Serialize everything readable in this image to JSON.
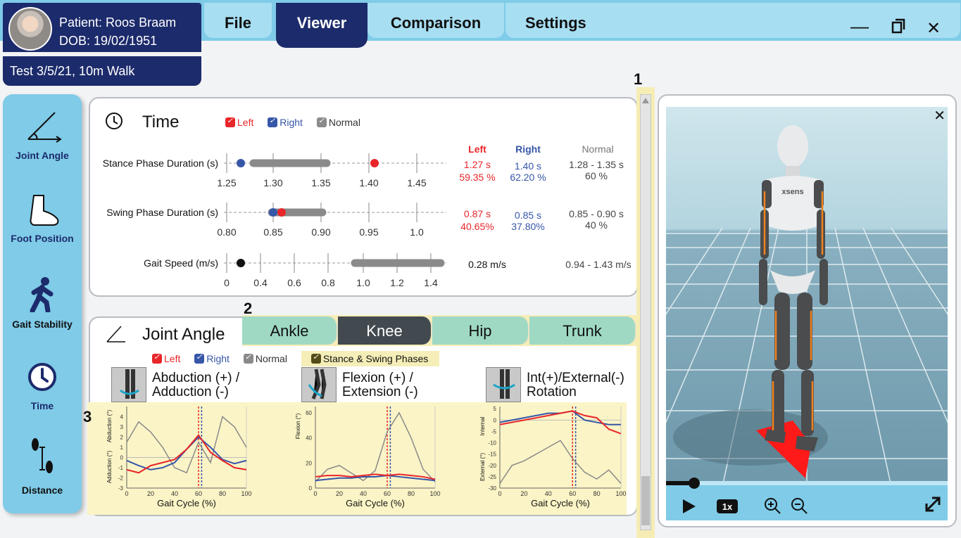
{
  "patient": {
    "name": "Patient: Roos Braam",
    "dob": "DOB: 19/02/1951",
    "test": "Test 3/5/21, 10m Walk"
  },
  "tabs": [
    {
      "label": "File"
    },
    {
      "label": "Viewer"
    },
    {
      "label": "Comparison"
    },
    {
      "label": "Settings"
    }
  ],
  "sidebar": {
    "items": [
      {
        "label": "Joint Angle"
      },
      {
        "label": "Foot Position"
      },
      {
        "label": "Gait Stability"
      },
      {
        "label": "Time"
      },
      {
        "label": "Distance"
      }
    ]
  },
  "colors": {
    "left": "#e8262a",
    "right": "#3656a8",
    "normal": "#8a8a8a",
    "accent": "#7fcbe8",
    "navy": "#1c2b6b"
  },
  "time_panel": {
    "title": "Time",
    "legend": {
      "left": "Left",
      "right": "Right",
      "normal": "Normal"
    },
    "headers": {
      "left": "Left",
      "right": "Right",
      "normal": "Normal"
    },
    "rows": [
      {
        "label": "Stance Phase Duration (s)",
        "ticks": [
          "1.25",
          "1.30",
          "1.35",
          "1.40",
          "1.45"
        ],
        "left_value": "1.27 s",
        "left_pct": "59.35 %",
        "right_value": "1.40 s",
        "right_pct": "62.20 %",
        "normal_value": "1.28 - 1.35 s",
        "normal_pct": "60 %"
      },
      {
        "label": "Swing Phase Duration (s)",
        "ticks": [
          "0.80",
          "0.85",
          "0.90",
          "0.95",
          "1.0"
        ],
        "left_value": "0.87 s",
        "left_pct": "40.65%",
        "right_value": "0.85 s",
        "right_pct": "37.80%",
        "normal_value": "0.85 - 0.90 s",
        "normal_pct": "40 %"
      },
      {
        "label": "Gait Speed (m/s)",
        "ticks": [
          "0",
          "0.4",
          "0.6",
          "0.8",
          "1.0",
          "1.2",
          "1.4"
        ],
        "value": "0.28 m/s",
        "normal_value": "0.94 - 1.43 m/s"
      }
    ]
  },
  "joint_panel": {
    "title": "Joint Angle",
    "tabs": [
      "Ankle",
      "Knee",
      "Hip",
      "Trunk"
    ],
    "active_tab": "Knee",
    "legend": {
      "left": "Left",
      "right": "Right",
      "normal": "Normal",
      "phases": "Stance & Swing Phases"
    },
    "charts": [
      {
        "title1": "Abduction (+) /",
        "title2": "Adduction (-)",
        "ylabel_top": "Abduction (°)",
        "ylabel_bottom": "Adduction (°)",
        "xlabel": "Gait Cycle (%)"
      },
      {
        "title1": "Flexion (+) /",
        "title2": "Extension (-)",
        "ylabel_top": "Flexion (°)",
        "ylabel_bottom": "",
        "xlabel": "Gait Cycle (%)"
      },
      {
        "title1": "Int(+)/External(-)",
        "title2": "Rotation",
        "ylabel_top": "Internal",
        "ylabel_bottom": "External (°)",
        "xlabel": "Gait Cycle (%)"
      }
    ]
  },
  "chart_data": [
    {
      "type": "line",
      "x": [
        0,
        10,
        20,
        30,
        40,
        50,
        60,
        70,
        80,
        90,
        100
      ],
      "xlim": [
        0,
        100
      ],
      "ylim": [
        -3,
        5
      ],
      "yticks": [
        "4",
        "3",
        "2",
        "1",
        "0",
        "-1",
        "-2",
        "-3"
      ],
      "xticks": [
        "0",
        "20",
        "40",
        "60",
        "80",
        "100"
      ],
      "phase_markers": [
        60,
        62
      ],
      "series": [
        {
          "values": [
            -1.2,
            -1.5,
            -0.8,
            -0.5,
            -0.2,
            0.8,
            2.2,
            0.5,
            -0.3,
            -1.0,
            -1.2
          ]
        },
        {
          "values": [
            -0.3,
            -0.8,
            -1.2,
            -1.0,
            -0.5,
            0.8,
            2.0,
            1.0,
            -0.2,
            -0.6,
            -0.3
          ]
        },
        {
          "values": [
            1.5,
            3.5,
            2.5,
            1.0,
            -1.0,
            -1.5,
            1.5,
            -0.5,
            4.0,
            3.0,
            1.0
          ]
        }
      ]
    },
    {
      "type": "line",
      "x": [
        0,
        10,
        20,
        30,
        40,
        50,
        60,
        70,
        80,
        90,
        100
      ],
      "xlim": [
        0,
        100
      ],
      "ylim": [
        0,
        65
      ],
      "yticks": [
        "60",
        "40",
        "20",
        "0"
      ],
      "xticks": [
        "0",
        "20",
        "40",
        "60",
        "80",
        "100"
      ],
      "phase_markers": [
        60,
        62
      ],
      "series": [
        {
          "values": [
            9,
            10,
            10,
            9,
            10,
            11,
            10,
            11,
            10,
            9,
            7
          ]
        },
        {
          "values": [
            6,
            7,
            8,
            8,
            9,
            9,
            10,
            9,
            8,
            7,
            6
          ]
        },
        {
          "values": [
            5,
            15,
            18,
            12,
            6,
            14,
            45,
            60,
            40,
            15,
            5
          ]
        }
      ]
    },
    {
      "type": "line",
      "x": [
        0,
        10,
        20,
        30,
        40,
        50,
        60,
        70,
        80,
        90,
        100
      ],
      "xlim": [
        0,
        100
      ],
      "ylim": [
        -30,
        6
      ],
      "yticks": [
        "5",
        "0",
        "-5",
        "-10",
        "-15",
        "-20",
        "-25",
        "-30"
      ],
      "xticks": [
        "0",
        "20",
        "40",
        "60",
        "80",
        "100"
      ],
      "phase_markers": [
        60,
        62
      ],
      "series": [
        {
          "values": [
            -2,
            -1,
            0,
            1,
            2,
            3,
            4,
            2,
            1,
            -4,
            -6
          ]
        },
        {
          "values": [
            -1,
            0,
            1,
            2,
            3,
            3,
            4,
            0,
            -1,
            -2,
            -2
          ]
        },
        {
          "values": [
            -28,
            -20,
            -18,
            -15,
            -12,
            -9,
            -17,
            -23,
            -26,
            -22,
            -28
          ]
        }
      ]
    }
  ],
  "viewer": {
    "close": "✕",
    "speed": "1x",
    "brand": "xsens",
    "playback_progress": 0.1
  },
  "annotations": [
    "1",
    "2",
    "3"
  ]
}
